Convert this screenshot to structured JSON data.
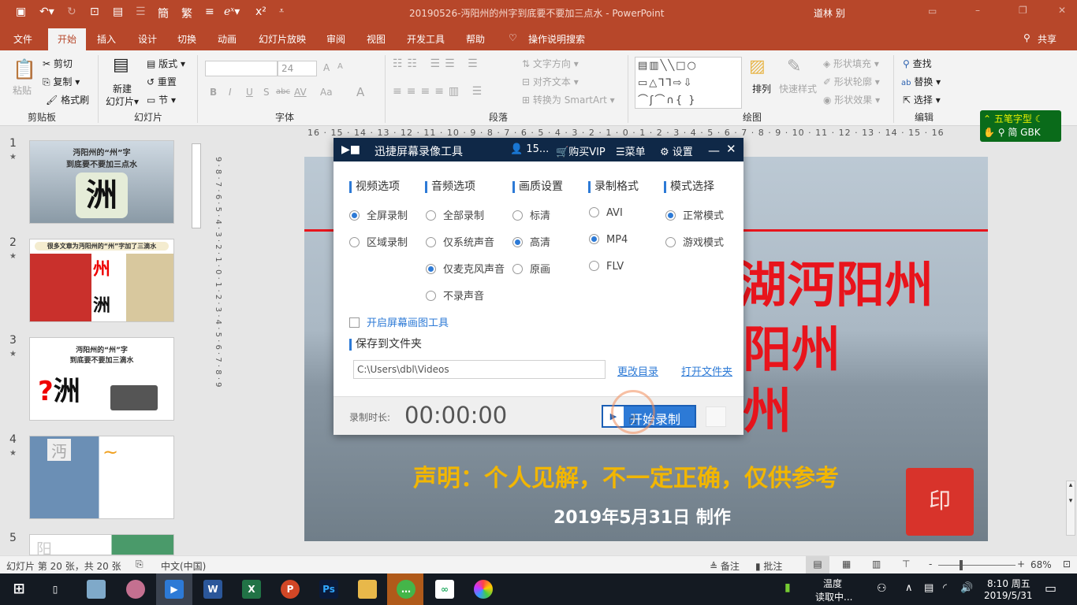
{
  "titlebar": {
    "document_title": "20190526-沔阳州的州字到底要不要加三点水  -  PowerPoint",
    "user": "道林 别",
    "qa_icons": [
      "save-icon",
      "undo-icon",
      "redo-icon",
      "present-icon",
      "slide-icon",
      "outline-icon",
      "simplified-icon",
      "traditional-icon",
      "align-icon",
      "equation-icon",
      "superscript-icon",
      "customize-icon"
    ],
    "accent": "#b7472a"
  },
  "tabs": [
    "文件",
    "开始",
    "插入",
    "设计",
    "切换",
    "动画",
    "幻灯片放映",
    "审阅",
    "视图",
    "开发工具",
    "帮助"
  ],
  "active_tab": "开始",
  "tell_me": "操作说明搜索",
  "share": "共享",
  "ribbon": {
    "clipboard": {
      "paste": "粘贴",
      "cut": "剪切",
      "copy": "复制",
      "format_painter": "格式刷",
      "label": "剪贴板"
    },
    "slides": {
      "new_slide_1": "新建",
      "new_slide_2": "幻灯片",
      "layout": "版式",
      "reset": "重置",
      "section": "节",
      "label": "幻灯片"
    },
    "font": {
      "font_name": "",
      "font_size": "24",
      "bold": "B",
      "italic": "I",
      "underline": "U",
      "shadow": "S",
      "strike": "abc",
      "spacing": "AV",
      "case": "Aa",
      "color": "A",
      "grow": "A",
      "shrink": "A",
      "label": "字体"
    },
    "paragraph": {
      "text_direction": "文字方向",
      "align_text": "对齐文本",
      "smartart": "转换为 SmartArt",
      "label": "段落"
    },
    "drawing": {
      "arrange": "排列",
      "quick_styles": "快速样式",
      "fill": "形状填充",
      "outline": "形状轮廓",
      "effects": "形状效果",
      "label": "绘图"
    },
    "editing": {
      "find": "查找",
      "replace": "替换",
      "select": "选择",
      "label": "编辑"
    }
  },
  "ime": {
    "mode": "五笔字型",
    "line2": "简 GBK"
  },
  "ruler": "16 · 15 · 14 · 13 · 12 · 11 · 10 · 9 · 8 · 7 · 6 · 5 · 4 · 3 · 2 · 1 · 0 · 1 · 2 · 3 · 4 · 5 · 6 · 7 · 8 · 9 · 10 · 11 · 12 · 13 · 14 · 15 · 16",
  "vruler": "9 · 8 · 7 · 6 · 5 · 4 · 3 · 2 · 1 · 0 · 1 · 2 · 3 · 4 · 5 · 6 · 7 · 8 · 9",
  "thumbnails": [
    {
      "num": "1",
      "title1": "沔阳州的“州”字",
      "title2": "到底要不要加三点水",
      "big": "洲"
    },
    {
      "num": "2",
      "title1": "很多文章为沔阳州的“州”字加了三滴水",
      "big": "州",
      "big2": "洲"
    },
    {
      "num": "3",
      "title1": "沔阳州的“州”字",
      "title2": "到底要不要加三滴水",
      "big": "洲"
    },
    {
      "num": "4",
      "big": "沔"
    },
    {
      "num": "5",
      "big": "阳"
    }
  ],
  "slide": {
    "lines": [
      "湖沔阳州",
      "阳州",
      "州"
    ],
    "disclaimer": "声明：个人见解，不一定正确，仅供参考",
    "date": "2019年5月31日 制作",
    "red": "#e8141c",
    "yellow": "#f2b600"
  },
  "recorder": {
    "title": "迅捷屏幕录像工具",
    "user": "15...",
    "buy_vip": "购买VIP",
    "menu": "菜单",
    "settings": "设置",
    "sections": {
      "video": {
        "label": "视频选项",
        "options": [
          {
            "label": "全屏录制",
            "selected": true
          },
          {
            "label": "区域录制",
            "selected": false
          }
        ]
      },
      "audio": {
        "label": "音频选项",
        "options": [
          {
            "label": "全部录制",
            "selected": false
          },
          {
            "label": "仅系统声音",
            "selected": false
          },
          {
            "label": "仅麦克风声音",
            "selected": true
          },
          {
            "label": "不录声音",
            "selected": false
          }
        ]
      },
      "quality": {
        "label": "画质设置",
        "options": [
          {
            "label": "标清",
            "selected": false
          },
          {
            "label": "高清",
            "selected": true
          },
          {
            "label": "原画",
            "selected": false
          }
        ]
      },
      "format": {
        "label": "录制格式",
        "options": [
          {
            "label": "AVI",
            "selected": false
          },
          {
            "label": "MP4",
            "selected": true
          },
          {
            "label": "FLV",
            "selected": false
          }
        ]
      },
      "mode": {
        "label": "模式选择",
        "options": [
          {
            "label": "正常模式",
            "selected": true
          },
          {
            "label": "游戏模式",
            "selected": false
          }
        ]
      }
    },
    "drawing_tool": {
      "label": "开启屏幕画图工具",
      "checked": false
    },
    "save_label": "保存到文件夹",
    "save_path": "C:\\Users\\dbl\\Videos",
    "change_dir": "更改目录",
    "open_folder": "打开文件夹",
    "duration_label": "录制时长:",
    "duration": "00:00:00",
    "start": "开始录制",
    "accent": "#2d7ad6",
    "header_color": "#0f2847"
  },
  "statusbar": {
    "slide_info": "幻灯片 第 20 张，共 20 张",
    "language": "中文(中国)",
    "notes": "备注",
    "comments": "批注",
    "zoom": "68%",
    "zoom_minus": "-",
    "zoom_plus": "+"
  },
  "taskbar": {
    "apps": [
      "start-icon",
      "task-view-icon",
      "app-icon",
      "app-icon",
      "recorder-icon",
      "word-icon",
      "excel-icon",
      "powerpoint-icon",
      "photoshop-icon",
      "file-explorer-icon",
      "wechat-icon",
      "sync-icon",
      "color-icon"
    ],
    "word": "W",
    "excel": "X",
    "powerpoint": "P",
    "photoshop": "Ps",
    "temp_1": "温度",
    "temp_2": "读取中...",
    "time": "8:10 周五",
    "date": "2019/5/31"
  }
}
